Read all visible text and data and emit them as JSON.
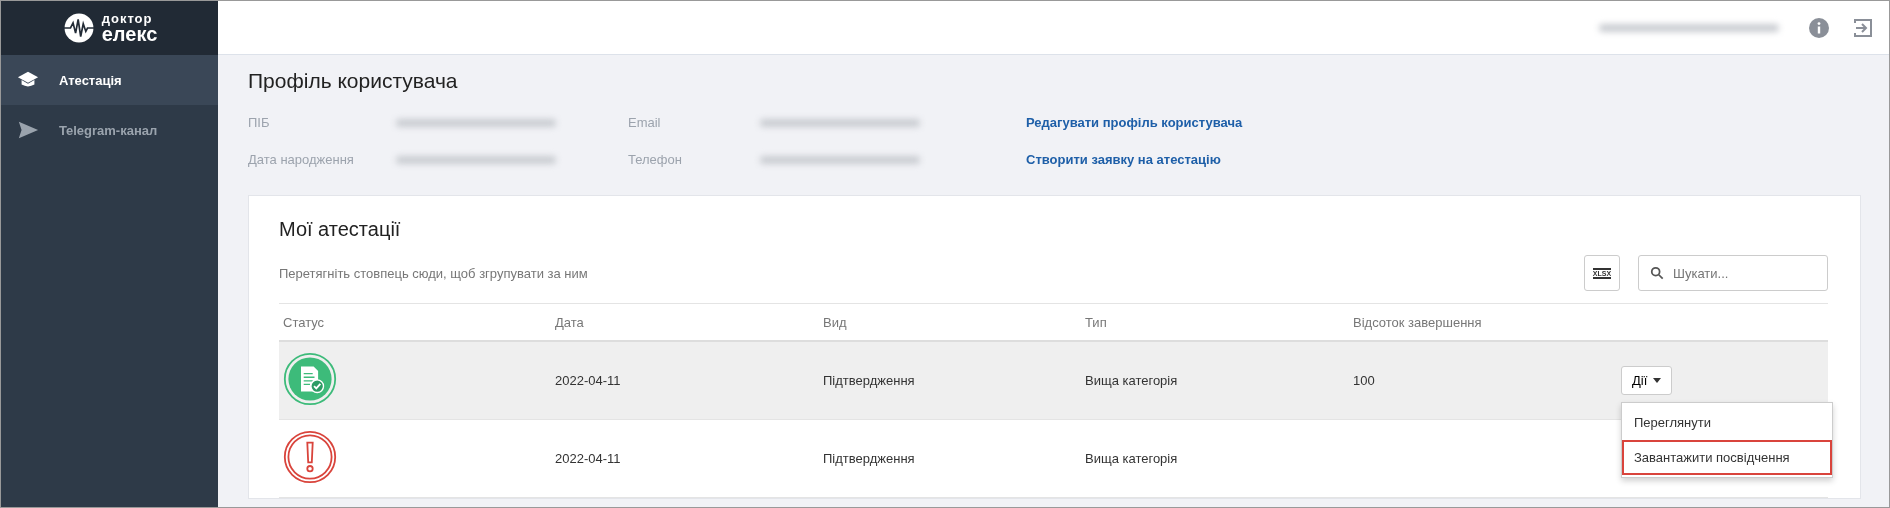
{
  "sidebar": {
    "logo": {
      "line1": "доктор",
      "line2": "елекс"
    },
    "items": [
      {
        "label": "Атестація",
        "kind": "certification",
        "selected": true
      },
      {
        "label": "Telegram-канал",
        "kind": "telegram",
        "selected": false
      }
    ]
  },
  "profile": {
    "title": "Профіль користувача",
    "fields": [
      {
        "label": "ПІБ"
      },
      {
        "label": "Email"
      },
      {
        "label": "Дата народження"
      },
      {
        "label": "Телефон"
      }
    ],
    "links": [
      "Редагувати профіль користувача",
      "Створити заявку на атестацію"
    ]
  },
  "attestations": {
    "title": "Мої атестації",
    "group_hint": "Перетягніть стовпець сюди, щоб згрупувати за ним",
    "export_label": "XLSX",
    "search": {
      "placeholder": "Шукати..."
    },
    "columns": [
      "Статус",
      "Дата",
      "Вид",
      "Тип",
      "Відсоток завершення"
    ],
    "rows": [
      {
        "kind": "completed",
        "date": "2022-04-11",
        "kind_of": "Підтвердження",
        "type": "Вища категорія",
        "percent": "100",
        "selected": true,
        "actions": "Дії"
      },
      {
        "kind": "warning",
        "date": "2022-04-11",
        "kind_of": "Підтвердження",
        "type": "Вища категорія",
        "percent": "",
        "selected": false
      }
    ],
    "menu": [
      {
        "label": "Переглянути",
        "highlighted": false
      },
      {
        "label": "Завантажити посвідчення",
        "highlighted": true
      }
    ]
  }
}
